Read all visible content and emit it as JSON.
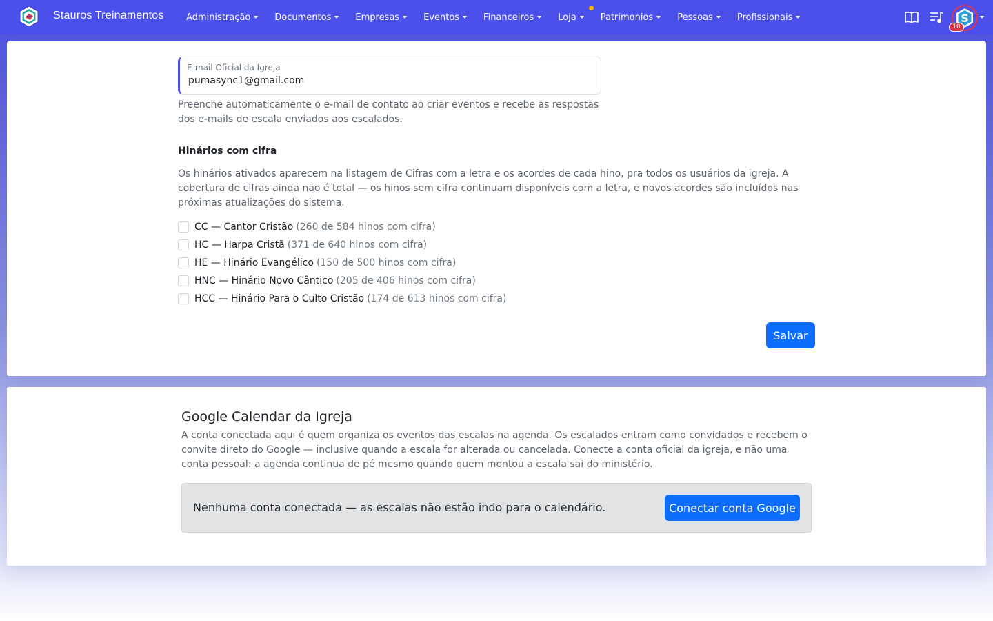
{
  "navbar": {
    "brand": "Stauros Treinamentos",
    "menu": [
      {
        "label": "Administração"
      },
      {
        "label": "Documentos"
      },
      {
        "label": "Empresas"
      },
      {
        "label": "Eventos"
      },
      {
        "label": "Financeiros"
      },
      {
        "label": "Loja"
      },
      {
        "label": "Patrimonios"
      },
      {
        "label": "Pessoas"
      },
      {
        "label": "Profissionais"
      }
    ],
    "icons": [
      "book-icon",
      "music-playlist-icon"
    ],
    "notification_count": "10",
    "colors": {
      "background": "#4c50ea",
      "notification_dot": "#f5b400",
      "avatar_ring": "#e5334a"
    }
  },
  "email_section": {
    "label": "E-mail Oficial da Igreja",
    "value": "pumasync1@gmail.com",
    "help": "Preenche automaticamente o e-mail de contato ao criar eventos e recebe as respostas dos e-mails de escala enviados aos escalados."
  },
  "hymnals_section": {
    "title": "Hinários com cifra",
    "description": "Os hinários ativados aparecem na listagem de Cifras com a letra e os acordes de cada hino, pra todos os usuários da igreja. A cobertura de cifras ainda não é total — os hinos sem cifra continuam disponíveis com a letra, e novos acordes são incluídos nas próximas atualizações do sistema.",
    "items": [
      {
        "name": "CC — Cantor Cristão",
        "count": "(260 de 584 hinos com cifra)",
        "checked": false
      },
      {
        "name": "HC — Harpa Cristã",
        "count": "(371 de 640 hinos com cifra)",
        "checked": false
      },
      {
        "name": "HE — Hinário Evangélico",
        "count": "(150 de 500 hinos com cifra)",
        "checked": false
      },
      {
        "name": "HNC — Hinário Novo Cântico",
        "count": "(205 de 406 hinos com cifra)",
        "checked": false
      },
      {
        "name": "HCC — Hinário Para o Culto Cristão",
        "count": "(174 de 613 hinos com cifra)",
        "checked": false
      }
    ],
    "save_label": "Salvar"
  },
  "google_calendar": {
    "title": "Google Calendar da Igreja",
    "description": "A conta conectada aqui é quem organiza os eventos das escalas na agenda. Os escalados entram como convidados e recebem o convite direto do Google — inclusive quando a escala for alterada ou cancelada. Conecte a conta oficial da igreja, e não uma conta pessoal: a agenda continua de pé mesmo quando quem montou a escala sai do ministério.",
    "status": "Nenhuma conta conectada — as escalas não estão indo para o calendário.",
    "connect_label": "Conectar conta Google"
  }
}
